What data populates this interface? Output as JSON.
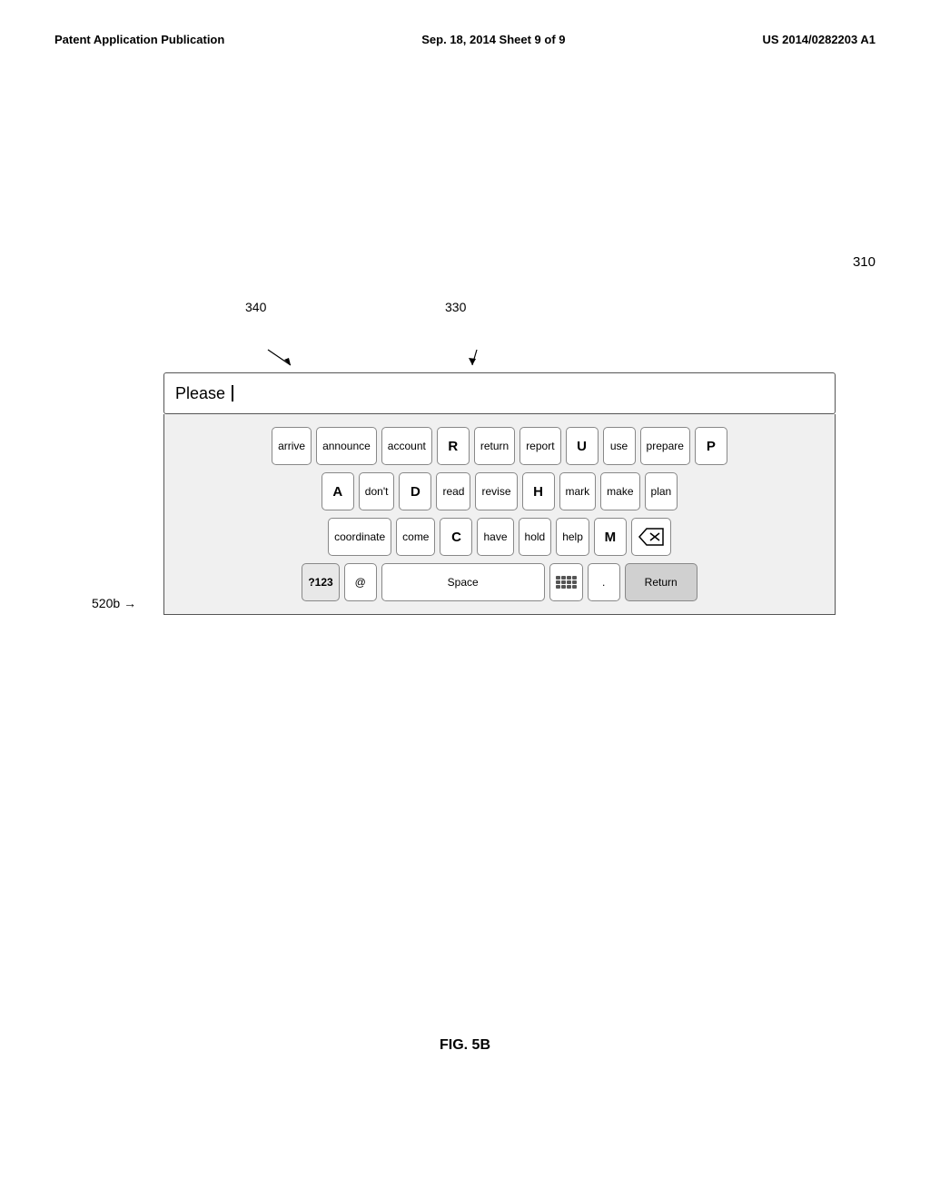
{
  "header": {
    "left": "Patent Application Publication",
    "center": "Sep. 18, 2014   Sheet 9 of 9",
    "right": "US 2014/0282203 A1"
  },
  "refs": {
    "ref310": "310",
    "ref520b": "520b",
    "ref340": "340",
    "ref330": "330"
  },
  "input_text": "Please",
  "keyboard": {
    "row1": [
      "arrive",
      "announce",
      "account",
      "R",
      "return",
      "report",
      "U",
      "use",
      "prepare",
      "P"
    ],
    "row2": [
      "A",
      "don't",
      "D",
      "read",
      "revise",
      "H",
      "mark",
      "make",
      "plan"
    ],
    "row3": [
      "coordinate",
      "come",
      "C",
      "have",
      "hold",
      "help",
      "M",
      "⌫"
    ],
    "row4": [
      "?123",
      "@",
      "Space",
      "⌨",
      ".",
      "Return"
    ]
  },
  "fig_label": "FIG. 5B"
}
